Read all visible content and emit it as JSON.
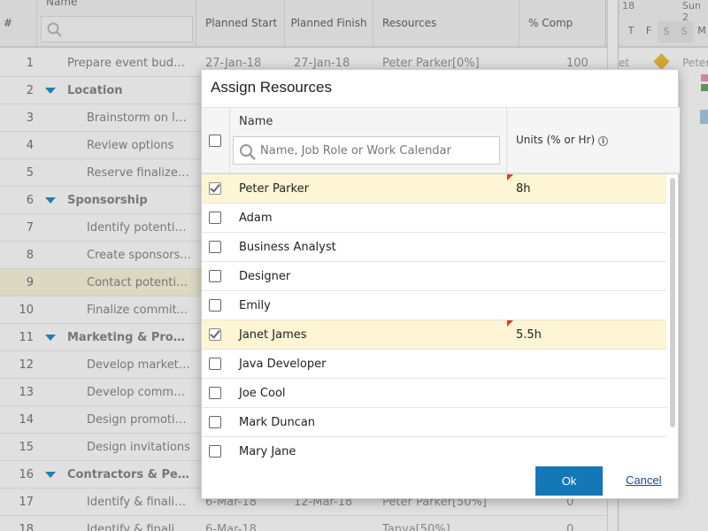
{
  "grid": {
    "headers": {
      "index": "#",
      "name": "Name",
      "planned_start": "Planned Start",
      "planned_finish": "Planned Finish",
      "resources": "Resources",
      "percent_complete": "% Comp"
    },
    "rows": [
      {
        "idx": "1",
        "name": "Prepare event budget",
        "start": "27-Jan-18",
        "finish": "27-Jan-18",
        "resources": "Peter Parker[0%]",
        "comp": "100"
      },
      {
        "idx": "2",
        "name": "Location",
        "start": "",
        "finish": "",
        "resources": "",
        "comp": ""
      },
      {
        "idx": "3",
        "name": "Brainstorm on lo...",
        "start": "",
        "finish": "",
        "resources": "",
        "comp": ""
      },
      {
        "idx": "4",
        "name": "Review options",
        "start": "",
        "finish": "",
        "resources": "",
        "comp": ""
      },
      {
        "idx": "5",
        "name": "Reserve finalized...",
        "start": "",
        "finish": "",
        "resources": "",
        "comp": ""
      },
      {
        "idx": "6",
        "name": "Sponsorship",
        "start": "",
        "finish": "",
        "resources": "",
        "comp": ""
      },
      {
        "idx": "7",
        "name": "Identify potential...",
        "start": "",
        "finish": "",
        "resources": "",
        "comp": ""
      },
      {
        "idx": "8",
        "name": "Create sponsors...",
        "start": "",
        "finish": "",
        "resources": "",
        "comp": ""
      },
      {
        "idx": "9",
        "name": "Contact potentia...",
        "start": "",
        "finish": "",
        "resources": "",
        "comp": ""
      },
      {
        "idx": "10",
        "name": "Finalize commit...",
        "start": "",
        "finish": "",
        "resources": "",
        "comp": ""
      },
      {
        "idx": "11",
        "name": "Marketing & Promo...",
        "start": "",
        "finish": "",
        "resources": "",
        "comp": ""
      },
      {
        "idx": "12",
        "name": "Develop marketi...",
        "start": "",
        "finish": "",
        "resources": "",
        "comp": ""
      },
      {
        "idx": "13",
        "name": "Develop commu...",
        "start": "",
        "finish": "",
        "resources": "",
        "comp": ""
      },
      {
        "idx": "14",
        "name": "Design promotio...",
        "start": "",
        "finish": "",
        "resources": "",
        "comp": ""
      },
      {
        "idx": "15",
        "name": "Design invitations",
        "start": "",
        "finish": "",
        "resources": "",
        "comp": ""
      },
      {
        "idx": "16",
        "name": "Contractors & Perm...",
        "start": "",
        "finish": "",
        "resources": "",
        "comp": ""
      },
      {
        "idx": "17",
        "name": "Identify & finaliz...",
        "start": "6-Mar-18",
        "finish": "12-Mar-18",
        "resources": "Peter Parker[50%]",
        "comp": "0"
      },
      {
        "idx": "18",
        "name": "Identify & finaliz...",
        "start": "6-Mar-18",
        "finish": "",
        "resources": "Tanya[50%]",
        "comp": "0"
      }
    ]
  },
  "gantt": {
    "week_label_left": "18",
    "week_label_right": "Sun 2",
    "days": [
      "T",
      "F",
      "S",
      "S",
      "M"
    ],
    "row1_text": "et",
    "row1_resource": "Peter"
  },
  "dialog": {
    "title": "Assign Resources",
    "name_header": "Name",
    "search_placeholder": "Name, Job Role or Work Calendar",
    "units_header": "Units (% or Hr)",
    "info_glyph": "i",
    "resources": [
      {
        "name": "Peter Parker",
        "units": "8h",
        "checked": true
      },
      {
        "name": "Adam",
        "units": "",
        "checked": false
      },
      {
        "name": "Business Analyst",
        "units": "",
        "checked": false
      },
      {
        "name": "Designer",
        "units": "",
        "checked": false
      },
      {
        "name": "Emily",
        "units": "",
        "checked": false
      },
      {
        "name": "Janet James",
        "units": "5.5h",
        "checked": true
      },
      {
        "name": "Java Developer",
        "units": "",
        "checked": false
      },
      {
        "name": "Joe Cool",
        "units": "",
        "checked": false
      },
      {
        "name": "Mark Duncan",
        "units": "",
        "checked": false
      },
      {
        "name": "Mary Jane",
        "units": "",
        "checked": false
      }
    ],
    "ok_label": "Ok",
    "cancel_label": "Cancel"
  },
  "colors": {
    "accent": "#1478b8",
    "selected_row": "#fdf5d3",
    "highlight_row": "#fbf6dc",
    "edit_flag": "#e03a1a",
    "tree_caret": "#2a8fc8"
  }
}
